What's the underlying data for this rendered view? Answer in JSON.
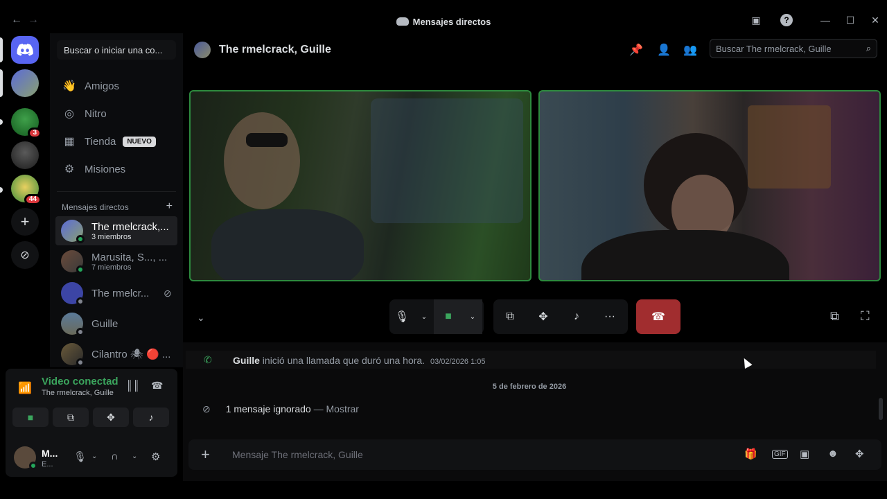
{
  "window": {
    "title": "Mensajes directos"
  },
  "sidebar": {
    "search_label": "Buscar o iniciar una co...",
    "nav": [
      {
        "label": "Amigos",
        "icon": "friends-icon"
      },
      {
        "label": "Nitro",
        "icon": "nitro-icon"
      },
      {
        "label": "Tienda",
        "icon": "shop-icon",
        "badge": "NUEVO"
      },
      {
        "label": "Misiones",
        "icon": "quests-icon"
      }
    ],
    "dm_header": "Mensajes directos",
    "dms": [
      {
        "name": "The rmelcrack,...",
        "sub": "3 miembros",
        "active": true
      },
      {
        "name": "Marusita, S..., ...",
        "sub": "7 miembros"
      },
      {
        "name": "The rmelcr...",
        "sub": ""
      },
      {
        "name": "Guille",
        "sub": ""
      },
      {
        "name": "Cilantro 🕷 🔴 ...",
        "sub": ""
      }
    ]
  },
  "servers": {
    "badges": [
      "3",
      "44"
    ]
  },
  "voice": {
    "status": "Video conectado",
    "channel": "The rmelcrack, Guille"
  },
  "user": {
    "name": "M...",
    "status": "E..."
  },
  "channel": {
    "title": "The rmelcrack, Guille",
    "search_placeholder": "Buscar The rmelcrack, Guille"
  },
  "messages": {
    "call_user": "Guille",
    "call_text": "inició una llamada que duró una hora.",
    "call_time": "03/02/2026 1:05",
    "date_divider": "5 de febrero de 2026",
    "ignored_text": "1 mensaje ignorado",
    "ignored_sep": " — ",
    "ignored_show": "Mostrar",
    "composer_placeholder": "Mensaje The rmelcrack, Guille"
  },
  "colors": {
    "accent": "#5865f2",
    "connected": "#3ba55d",
    "hangup": "#a12d2f",
    "badge": "#da373c"
  }
}
